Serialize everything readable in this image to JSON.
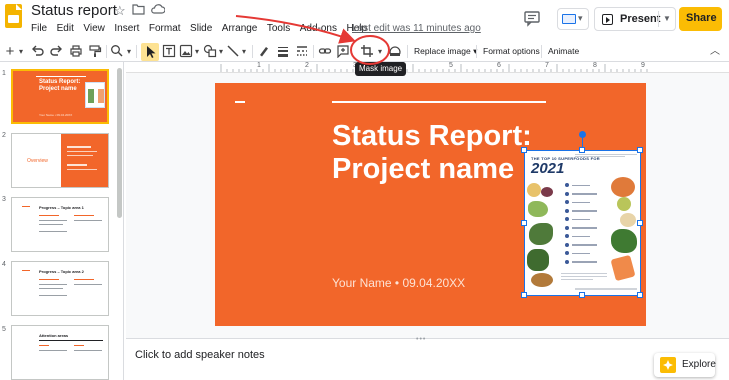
{
  "app": {
    "title": "Status report",
    "last_edit": "Last edit was 11 minutes ago"
  },
  "menu": [
    "File",
    "Edit",
    "View",
    "Insert",
    "Format",
    "Slide",
    "Arrange",
    "Tools",
    "Add-ons",
    "Help"
  ],
  "header": {
    "present_label": "Present",
    "share_label": "Share"
  },
  "toolbar": {
    "replace_image_label": "Replace image",
    "format_options_label": "Format options",
    "animate_label": "Animate",
    "tooltip": "Mask image"
  },
  "ruler": {
    "numbers": [
      "1",
      "2",
      "3",
      "4",
      "5",
      "6",
      "7",
      "8",
      "9"
    ]
  },
  "slides": [
    {
      "number": "1",
      "title": "Status Report: Project name",
      "subtitle": "Your Name • 09.04.20XX"
    },
    {
      "number": "2",
      "title": "Overview"
    },
    {
      "number": "3",
      "title": "Progress – Topic area 1"
    },
    {
      "number": "4",
      "title": "Progress – Topic area 2"
    },
    {
      "number": "5",
      "title": "Attention areas"
    }
  ],
  "main_slide": {
    "title_line1": "Status Report:",
    "title_line2": "Project name",
    "subtitle": "Your Name • 09.04.20XX",
    "image": {
      "heading": "THE TOP 10 SUPERFOODS FOR",
      "year": "2021"
    }
  },
  "notes": {
    "placeholder": "Click to add speaker notes"
  },
  "explore": {
    "label": "Explore"
  },
  "colors": {
    "slide_bg": "#f2662a",
    "accent_yellow": "#fbbc04",
    "selection_blue": "#1a73e8",
    "annotation_red": "#e53935"
  }
}
